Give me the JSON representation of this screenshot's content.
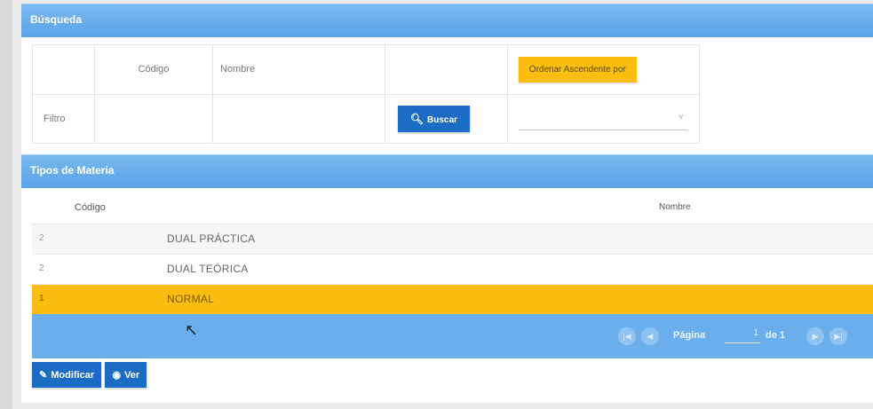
{
  "search_panel": {
    "title": "Búsqueda",
    "col_codigo": "Código",
    "col_nombre": "Nombre",
    "order_button": "Ordenar Ascendente por",
    "filter_label": "Filtro",
    "search_button": "Buscar",
    "search_icon": "magnifier",
    "order_select": {
      "value": "",
      "caret": "v"
    }
  },
  "grid_panel": {
    "title": "Tipos de Materia",
    "header_codigo": "Código",
    "header_nombre": "Nombre",
    "rows": [
      {
        "code": "2",
        "name": "DUAL PRÁCTICA",
        "selected": false
      },
      {
        "code": "2",
        "name": "DUAL TEÓRICA",
        "selected": false
      },
      {
        "code": "1",
        "name": "NORMAL",
        "selected": true
      }
    ]
  },
  "pager": {
    "page_label": "Página",
    "page_value": "1",
    "of_label": "de 1",
    "first_icon": "first-page-icon",
    "prev_icon": "prev-page-icon",
    "next_icon": "next-page-icon",
    "last_icon": "last-page-icon"
  },
  "actions": {
    "modify_label": "Modificar",
    "view_label": "Ver",
    "modify_icon": "pencil-icon",
    "view_icon": "eye-icon"
  },
  "colors": {
    "header_blue": "#5aa4e6",
    "button_blue": "#1b6cc4",
    "accent_yellow": "#fbbd0f"
  }
}
